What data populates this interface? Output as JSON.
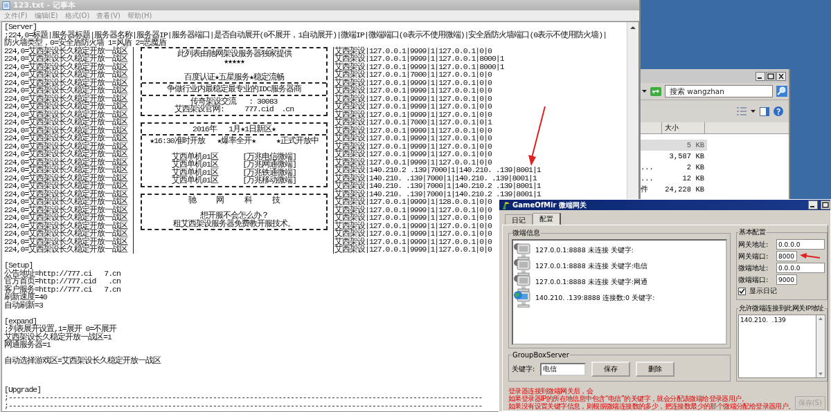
{
  "explorer": {
    "search": {
      "placeholder": "搜索 wangzhan"
    },
    "columns": [
      "大小"
    ],
    "rows": [
      {
        "size": "5 KB",
        "selected": true
      },
      {
        "size": "3,587 KB",
        "selected": false
      },
      {
        "name": "...",
        "size": "2 KB",
        "selected": false
      },
      {
        "name": "...",
        "size": "12 KB",
        "selected": false
      },
      {
        "name": "件",
        "size": "24,228 KB",
        "selected": false
      }
    ]
  },
  "notepad": {
    "title": "123.txt - 记事本",
    "menu": [
      "文件(F)",
      "编辑(E)",
      "格式(O)",
      "查看(V)",
      "帮助(H)"
    ],
    "header_lines": [
      "[Server]",
      ";224,0=标题|服务器标题|服务器名称|服务器IP|服务器端口|是否自动展开(0不展开，1自动展开)|微端IP|微端端口(0表示不使用微端)|安全盾防火墙端口(0表示不使用防火墙)|",
      "防火墙类型，0=安全盾防火墙 1=风盾 2=恶魔盾"
    ],
    "server_rows": [
      {
        "zone": "224,0=艾西架设长久稳定开放一战区",
        "detail": "艾西架设|127.0.0.1|9999|1|127.0.0.1|0|0"
      },
      {
        "zone": "224,0=艾西架设长久稳定开放一战区",
        "detail": "艾西架设|127.0.0.1|9999|1|127.0.0.1|8000|1"
      },
      {
        "zone": "224,0=艾西架设长久稳定开放一战区",
        "detail": "艾西架设|127.0.0.1|9999|1|127.0.0.1|8000|1"
      },
      {
        "zone": "224,0=艾西架设长久稳定开放一战区",
        "detail": "艾西架设|127.0.0.1|7000|1|127.0.0.1|0|0"
      },
      {
        "zone": "224,0=艾西架设长久稳定开放一战区",
        "detail": "艾西架设|127.0.0.1|9999|1|127.0.0.1|0|0"
      },
      {
        "zone": "224,0=艾西架设长久稳定开放一战区",
        "detail": "艾西架设|127.0.0.1|9999|1|127.0.0.1|0|0"
      },
      {
        "zone": "224,0=艾西架设长久稳定开放一战区",
        "detail": "艾西架设|127.0.0.1|9999|1|127.0.0.1|0|0"
      },
      {
        "zone": "224,0=艾西架设长久稳定开放一战区",
        "detail": "艾西架设|127.0.0.1|9999|1|127.0.0.1|0|0"
      },
      {
        "zone": "224,0=艾西架设长久稳定开放一战区",
        "detail": "艾西架设|127.0.0.1|9999|1|127.0.0.1|0|0"
      },
      {
        "zone": "224,0=艾西架设长久稳定开放一战区",
        "detail": "艾西架设|127.0.0.1|7000|1|127.0.0.1|0|1"
      },
      {
        "zone": "224,0=艾西架设长久稳定开放一战区",
        "detail": "艾西架设|127.0.0.1|9999|1|127.0.0.1|0|0"
      },
      {
        "zone": "224,0=艾西架设长久稳定开放一战区",
        "detail": "艾西架设|127.0.0.1|9999|1|127.0.0.1|0|0"
      },
      {
        "zone": "224,0=艾西架设长久稳定开放一战区",
        "detail": "艾西架设|127.0.0.1|9999|1|127.0.0.1|0|0"
      },
      {
        "zone": "224,0=艾西架设长久稳定开放一战区",
        "detail": "艾西架设|127.0.0.1|9999|1|127.0.0.1|0|0"
      },
      {
        "zone": "224,0=艾西架设长久稳定开放一战区",
        "detail": "艾西架设|127.0.0.1|9999|1|127.0.0.1|0|0"
      },
      {
        "zone": "224,0=艾西架设长久稳定开放一战区",
        "detail": "艾西架设|140.210.2 .139|7000|1|140.210. .139|8001|1"
      },
      {
        "zone": "224,0=艾西架设长久稳定开放一战区",
        "detail": "艾西架设|140.210. .139|7000|1|140.210. .139|8001|1"
      },
      {
        "zone": "224,0=艾西架设长久稳定开放一战区",
        "detail": "艾西架设|140.210. .139|7000|1|140.210.2 .139|8001|1"
      },
      {
        "zone": "224,0=艾西架设长久稳定开放一战区",
        "detail": "艾西架设|140.210. .139|7000|1|140.210.2 .139|8001|1"
      },
      {
        "zone": "224,0=艾西架设长久稳定开放一战区",
        "detail": "艾西架设|127.0.0.1|9999|1|128.0.0.1|0|0"
      },
      {
        "zone": "224,0=艾西架设长久稳定开放一战区",
        "detail": "艾西架设|127.0.0.1|9999|1|127.0.0.1|0|0"
      },
      {
        "zone": "224,0=艾西架设长久稳定开放一战区",
        "detail": "艾西架设|127.0.0.1|9999|1|127.0.0.1|0|0"
      },
      {
        "zone": "224,0=艾西架设长久稳定开放一战区",
        "detail": "艾西架设|127.0.0.1|9999|1|127.0.0.1|0|0"
      },
      {
        "zone": "224,0=艾西架设长久稳定开放一战区",
        "detail": "艾西架设|127.0.0.1|9999|1|127.0.0.1|0|0"
      },
      {
        "zone": "224,0=艾西架设长久稳定开放一战区",
        "detail": "艾西架设|127.0.0.1|9999|1|127.0.0.1|0|0"
      },
      {
        "zone": "224,0=艾西架设长久稳定开放一战区",
        "detail": "艾西架设|127.0.0.1|9999|1|127.0.0.1|0|0"
      }
    ],
    "banner": [
      {
        "sections": [
          [
            [
              "此列表由驰网架设服务器独家提供",
              "★★★★★"
            ],
            [
              "百度认证★五星服务★稳定流畅"
            ]
          ],
          [
            [
              "争做行业内最稳定最专业的IDC服务器商"
            ]
          ],
          [
            [
              "传奇架设交流   : 30083",
              "艾西架设官网:     777.cid  .cn"
            ]
          ]
        ]
      },
      {
        "sections": [
          [
            [
              "2016年   1月★1日新区★"
            ]
          ],
          [
            [
              "★16:30准时开放   ★爆率全开★     ★正式开放中"
            ],
            [
              "艾西单机01区      [万兆电信微端]",
              "艾西单机01区      [万兆网通微端]",
              "艾西单机01区      [万兆铁通微端]",
              "艾西单机01区      [万兆移动微端]"
            ]
          ]
        ]
      },
      {
        "sections": [
          [
            [
              "驰     网     科     技"
            ],
            [
              "想开服不会怎么办？",
              "租艾西架设服务器免费教开服技术。"
            ]
          ]
        ]
      }
    ],
    "footer_blocks": [
      [
        "[Setup]",
        "公告地址=http://777.ci   7.cn",
        "官方首页=http://777.cid   .cn",
        "客户服务=http://777.ci   7.cn",
        "刷新速度=40",
        "自动刷新=3"
      ],
      [
        "[expand]",
        ";列表展开设置,1=展开 0=不展开",
        "艾西架设长久稳定开放一战区=1",
        "网通服务器=1"
      ],
      [
        "自动选择游戏区=艾西架设长久稳定开放一战区"
      ]
    ],
    "end_block": [
      "[Upgrade]",
      ";--------------------------------------------------------------------------------------------------------------------",
      ";--------------------------------------------------------------------------------------------------------------------"
    ]
  },
  "dialog": {
    "title": "GameOfMir 微端网关",
    "tabs": [
      {
        "label": "日记",
        "selected": false
      },
      {
        "label": "配置",
        "selected": true
      }
    ],
    "info_group": {
      "title": "微端信息",
      "items": [
        {
          "kind": "local",
          "text": "127.0.0.1:8888 未连接 关键字:"
        },
        {
          "kind": "local",
          "text": "127.0.0.1:8888 未连接 关键字:电信"
        },
        {
          "kind": "local",
          "text": "127.0.0.1:8888 未连接 关键字:网通"
        },
        {
          "kind": "remote",
          "text": "140.210.  .139:8888 连接数:0 关键字:"
        }
      ]
    },
    "server_group": {
      "title": "GroupBoxServer",
      "keyword_label": "关键字:",
      "keyword_value": "电信",
      "buttons": [
        "保存",
        "删除"
      ]
    },
    "basic_group": {
      "title": "基本配置",
      "fields": [
        {
          "label": "网关地址:",
          "value": "0.0.0.0",
          "kind": "wide"
        },
        {
          "label": "网关端口:",
          "value": "8000",
          "kind": "short"
        },
        {
          "label": "微端地址:",
          "value": "0.0.0.0",
          "kind": "wide"
        },
        {
          "label": "微端端口:",
          "value": "9000",
          "kind": "short"
        }
      ],
      "show_log": {
        "label": "显示日记",
        "checked": true
      }
    },
    "allow_group": {
      "title": "允许微端连接到此网关IP地址",
      "value": "140.210.  .139"
    },
    "notes": [
      "登录器连接到微端网关后，会",
      "如果登录器IP的所在地信息中包含“电信”的关键字，就会分配该微端给登录器用户。",
      "如果没有设置关键字信息，则根据微端连接数的多少，把连接数最少的那个微端分配给登录器用户。"
    ],
    "save_button": {
      "label": "保存(S)",
      "disabled": true
    }
  }
}
